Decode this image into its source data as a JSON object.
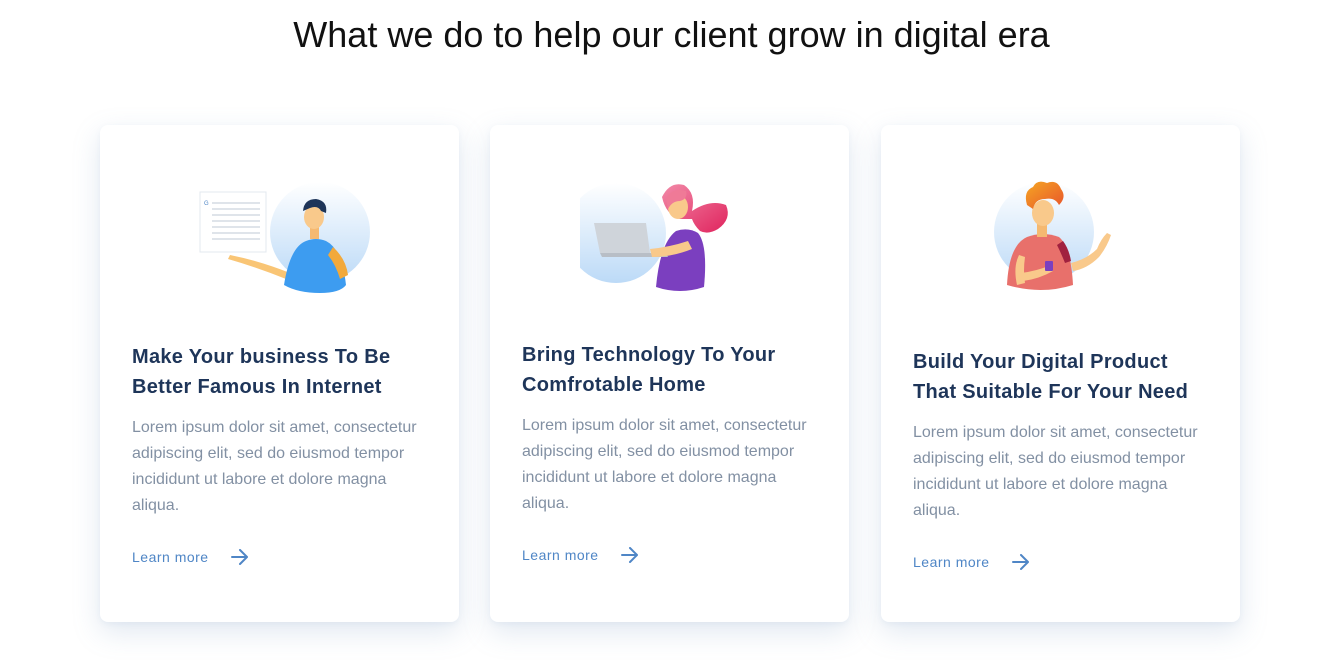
{
  "section": {
    "title": "What we do to help our client grow in digital era"
  },
  "cards": [
    {
      "illustration": "man-with-document-illustration",
      "title": "Make Your business To Be Better Famous In Internet",
      "description": "Lorem ipsum dolor sit amet, consectetur adipiscing elit, sed do eiusmod tempor incididunt ut labore et dolore magna aliqua.",
      "link_label": "Learn more",
      "link_icon": "arrow-right-icon"
    },
    {
      "illustration": "woman-with-laptop-illustration",
      "title": "Bring Technology To Your Comfrotable Home",
      "description": "Lorem ipsum dolor sit amet, consectetur adipiscing elit, sed do eiusmod tempor incididunt ut labore et dolore magna aliqua.",
      "link_label": "Learn more",
      "link_icon": "arrow-right-icon"
    },
    {
      "illustration": "man-with-phone-illustration",
      "title": "Build Your Digital Product That Suitable For Your Need",
      "description": "Lorem ipsum dolor sit amet, consectetur adipiscing elit, sed do eiusmod tempor incididunt ut labore et dolore magna aliqua.",
      "link_label": "Learn more",
      "link_icon": "arrow-right-icon"
    }
  ],
  "colors": {
    "heading": "#1e3559",
    "body_text": "#8290a3",
    "link": "#4f86c6",
    "title": "#111111"
  }
}
